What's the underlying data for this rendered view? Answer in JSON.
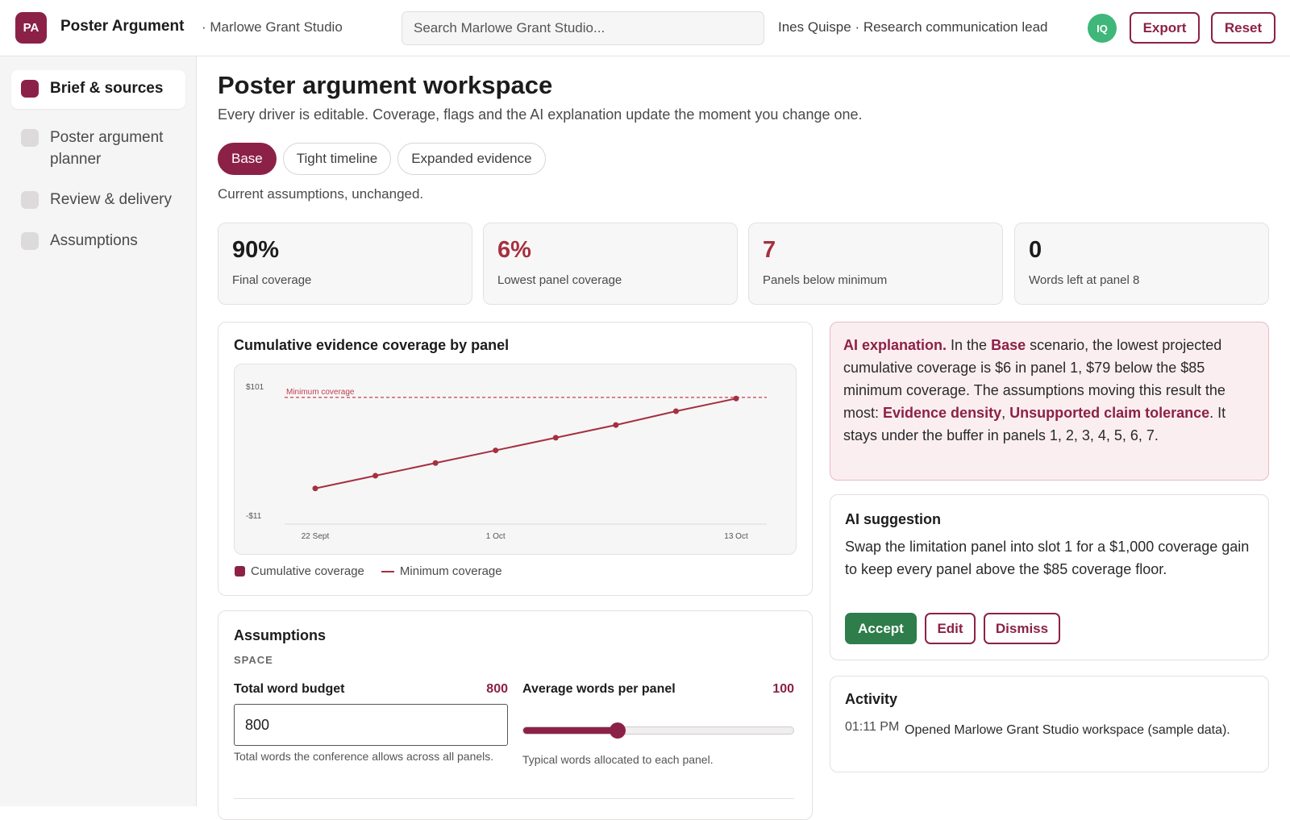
{
  "app": {
    "logo_initials": "PA",
    "title": "Poster Argument",
    "workspace": "· Marlowe Grant Studio",
    "search_placeholder": "Search Marlowe Grant Studio...",
    "user": "Ines Quispe · Research communication lead",
    "avatar_initials": "IQ",
    "export_label": "Export",
    "reset_label": "Reset"
  },
  "sidebar": {
    "items": [
      {
        "label": "Brief & sources",
        "active": true
      },
      {
        "label": "Poster argument planner",
        "active": false
      },
      {
        "label": "Review & delivery",
        "active": false
      },
      {
        "label": "Assumptions",
        "active": false
      }
    ]
  },
  "main": {
    "title": "Poster argument workspace",
    "subtitle": "Every driver is editable. Coverage, flags and the AI explanation update the moment you change one.",
    "scenarios": [
      "Base",
      "Tight timeline",
      "Expanded evidence"
    ],
    "active_scenario": "Base",
    "scenario_note": "Current assumptions, unchanged."
  },
  "kpis": [
    {
      "value": "90%",
      "label": "Final coverage",
      "alert": false
    },
    {
      "value": "6%",
      "label": "Lowest panel coverage",
      "alert": true
    },
    {
      "value": "7",
      "label": "Panels below minimum",
      "alert": true
    },
    {
      "value": "0",
      "label": "Words left at panel 8",
      "alert": false
    }
  ],
  "chart": {
    "title": "Cumulative evidence coverage by panel",
    "legend_series": "Cumulative coverage",
    "legend_threshold": "Minimum coverage"
  },
  "chart_data": {
    "type": "line",
    "x": [
      "22 Sept",
      "",
      "",
      "1 Oct",
      "",
      "",
      "",
      "13 Oct"
    ],
    "xticks": [
      "22 Sept",
      "1 Oct",
      "13 Oct"
    ],
    "yticks": [
      "$101",
      "-$11"
    ],
    "series": [
      {
        "name": "Cumulative coverage",
        "values": [
          6,
          17,
          28,
          39,
          50,
          61,
          73,
          84
        ]
      }
    ],
    "threshold": {
      "label": "Minimum coverage",
      "value": 85
    },
    "ylim": [
      -25,
      101
    ],
    "colors": {
      "series": "#a5303f",
      "threshold": "#c0404f"
    }
  },
  "ai_explanation": {
    "lead": "AI explanation.",
    "t1": " In the ",
    "scenario": "Base",
    "t2": " scenario, the lowest projected cumulative coverage is $6 in panel 1, $79 below the $85 minimum coverage. The assumptions moving this result the most: ",
    "driver1": "Evidence density",
    "t3": ", ",
    "driver2": "Unsupported claim tolerance",
    "t4": ". It stays under the buffer in panels 1, 2, 3, 4, 5, 6, 7."
  },
  "suggestion": {
    "title": "AI suggestion",
    "text": "Swap the limitation panel into slot 1 for a $1,000 coverage gain to keep every panel above the $85 coverage floor.",
    "accept": "Accept",
    "edit": "Edit",
    "dismiss": "Dismiss"
  },
  "activity": {
    "title": "Activity",
    "time": "01:11 PM",
    "text": "Opened Marlowe Grant Studio workspace (sample data)."
  },
  "assumptions": {
    "title": "Assumptions",
    "section": "SPACE",
    "word_budget": {
      "label": "Total word budget",
      "value": "800",
      "input_value": "800",
      "help": "Total words the conference allows across all panels."
    },
    "avg_words": {
      "label": "Average words per panel",
      "value": "100",
      "slider_fraction": 0.35,
      "help": "Typical words allocated to each panel."
    }
  },
  "colors": {
    "brand": "#8c2147",
    "alert": "#a5303f",
    "accept": "#2e7d4a",
    "avatar": "#3fb67a"
  }
}
